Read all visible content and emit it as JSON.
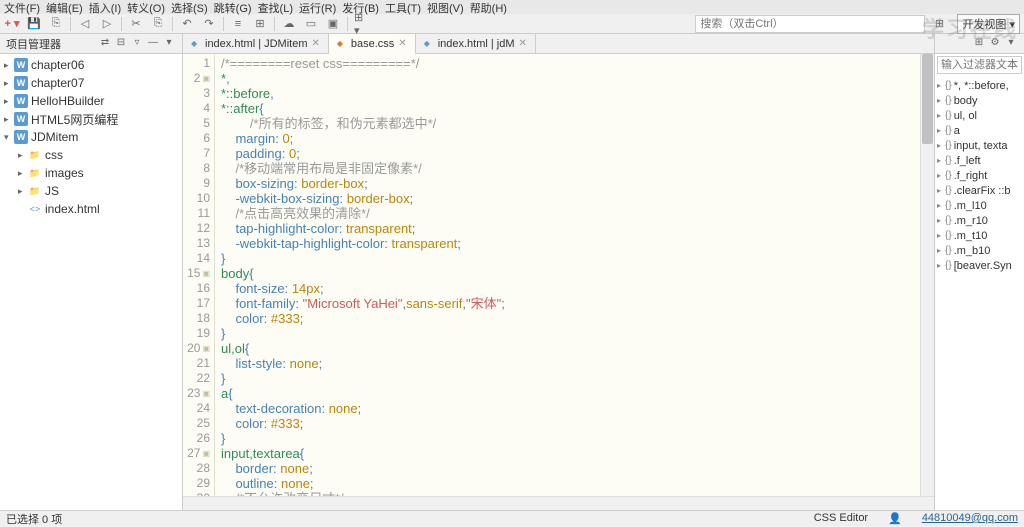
{
  "menu": [
    "文件(F)",
    "编辑(E)",
    "插入(I)",
    "转义(O)",
    "选择(S)",
    "跳转(G)",
    "查找(L)",
    "运行(R)",
    "发行(B)",
    "工具(T)",
    "视图(V)",
    "帮助(H)"
  ],
  "toolbar": {
    "search_placeholder": "搜索（双击Ctrl）",
    "devview": "开发视图"
  },
  "projectPanel": {
    "title": "项目管理器"
  },
  "projects": [
    {
      "label": "chapter06",
      "type": "w"
    },
    {
      "label": "chapter07",
      "type": "w"
    },
    {
      "label": "HelloHBuilder",
      "type": "w"
    },
    {
      "label": "HTML5网页编程",
      "type": "w"
    },
    {
      "label": "JDMitem",
      "type": "w",
      "open": true,
      "children": [
        {
          "label": "css",
          "type": "folder"
        },
        {
          "label": "images",
          "type": "folder"
        },
        {
          "label": "JS",
          "type": "folder"
        },
        {
          "label": "index.html",
          "type": "html"
        }
      ]
    }
  ],
  "tabs": [
    {
      "label": "index.html | JDMitem",
      "icon": "html",
      "active": false
    },
    {
      "label": "base.css",
      "icon": "css",
      "active": true
    },
    {
      "label": "index.html | jdM",
      "icon": "html",
      "active": false
    }
  ],
  "gutterStart": 1,
  "gutterEnd": 30,
  "foldLines": [
    2,
    15,
    20,
    23,
    27
  ],
  "code": [
    {
      "t": "cmt",
      "txt": "/*========reset css=========*/"
    },
    {
      "raw": "<span class='sel'>*</span><span class='punct'>,</span>"
    },
    {
      "raw": "<span class='sel'>*::before</span><span class='punct'>,</span>"
    },
    {
      "raw": "<span class='sel'>*::after</span><span class='br'>{</span>"
    },
    {
      "indent": 2,
      "t": "cmt",
      "txt": "/*所有的标签，和伪元素都选中*/"
    },
    {
      "indent": 1,
      "raw": "<span class='prop'>margin</span><span class='punct'>: </span><span class='val'>0</span><span class='punct'>;</span>"
    },
    {
      "indent": 1,
      "raw": "<span class='prop'>padding</span><span class='punct'>: </span><span class='val'>0</span><span class='punct'>;</span>"
    },
    {
      "indent": 1,
      "t": "cmt",
      "txt": "/*移动端常用布局是非固定像素*/"
    },
    {
      "indent": 1,
      "raw": "<span class='prop'>box-sizing</span><span class='punct'>: </span><span class='val'>border-box</span><span class='punct'>;</span>"
    },
    {
      "indent": 1,
      "raw": "<span class='prop'>-webkit-box-sizing</span><span class='punct'>: </span><span class='val'>border-box</span><span class='punct'>;</span>"
    },
    {
      "indent": 1,
      "t": "cmt",
      "txt": "/*点击高亮效果的清除*/"
    },
    {
      "indent": 1,
      "raw": "<span class='prop'>tap-highlight-color</span><span class='punct'>: </span><span class='val'>transparent</span><span class='punct'>;</span>"
    },
    {
      "indent": 1,
      "raw": "<span class='prop'>-webkit-tap-highlight-color</span><span class='punct'>: </span><span class='val'>transparent</span><span class='punct'>;</span>"
    },
    {
      "raw": "<span class='br'>}</span>"
    },
    {
      "raw": "<span class='sel'>body</span><span class='br'>{</span>"
    },
    {
      "indent": 1,
      "raw": "<span class='prop'>font-size</span><span class='punct'>: </span><span class='val'>14px</span><span class='punct'>;</span>"
    },
    {
      "indent": 1,
      "raw": "<span class='prop'>font-family</span><span class='punct'>: </span><span class='str'>\"Microsoft YaHei\"</span><span class='punct'>,</span><span class='val'>sans-serif</span><span class='punct'>,</span><span class='str'>\"宋体\"</span><span class='punct'>;</span>"
    },
    {
      "indent": 1,
      "raw": "<span class='prop'>color</span><span class='punct'>: </span><span class='val'>#333</span><span class='punct'>;</span>"
    },
    {
      "raw": "<span class='br'>}</span>"
    },
    {
      "raw": "<span class='sel'>ul,ol</span><span class='br'>{</span>"
    },
    {
      "indent": 1,
      "raw": "<span class='prop'>list-style</span><span class='punct'>: </span><span class='val'>none</span><span class='punct'>;</span>"
    },
    {
      "raw": "<span class='br'>}</span>"
    },
    {
      "raw": "<span class='sel'>a</span><span class='br'>{</span>"
    },
    {
      "indent": 1,
      "raw": "<span class='prop'>text-decoration</span><span class='punct'>: </span><span class='val'>none</span><span class='punct'>;</span>"
    },
    {
      "indent": 1,
      "raw": "<span class='prop'>color</span><span class='punct'>: </span><span class='val'>#333</span><span class='punct'>;</span>"
    },
    {
      "raw": "<span class='br'>}</span>"
    },
    {
      "raw": "<span class='sel'>input,textarea</span><span class='br'>{</span>"
    },
    {
      "indent": 1,
      "raw": "<span class='prop'>border</span><span class='punct'>: </span><span class='val'>none</span><span class='punct'>;</span>"
    },
    {
      "indent": 1,
      "raw": "<span class='prop'>outline</span><span class='punct'>: </span><span class='val'>none</span><span class='punct'>;</span>"
    },
    {
      "indent": 1,
      "t": "cmt",
      "txt": "/*不允许改变尺寸*/"
    }
  ],
  "outlineSearch": "输入过滤器文本",
  "outline": [
    {
      "label": "*, *::before,",
      "arrow": "▸"
    },
    {
      "label": "body",
      "arrow": "▸"
    },
    {
      "label": "ul, ol",
      "arrow": "▸"
    },
    {
      "label": "a",
      "arrow": "▸"
    },
    {
      "label": "input, texta",
      "arrow": "▸"
    },
    {
      "label": ".f_left",
      "arrow": "▸"
    },
    {
      "label": ".f_right",
      "arrow": "▸"
    },
    {
      "label": ".clearFix ::b",
      "arrow": "▸"
    },
    {
      "label": ".m_l10",
      "arrow": "▸"
    },
    {
      "label": ".m_r10",
      "arrow": "▸"
    },
    {
      "label": ".m_t10",
      "arrow": "▸"
    },
    {
      "label": ".m_b10",
      "arrow": "▸"
    },
    {
      "label": "[beaver.Syn",
      "arrow": "▸"
    }
  ],
  "status": {
    "left": "已选择 0 项",
    "editor": "CSS Editor",
    "email": "44810049@qq.com"
  },
  "watermark": "学习在线"
}
